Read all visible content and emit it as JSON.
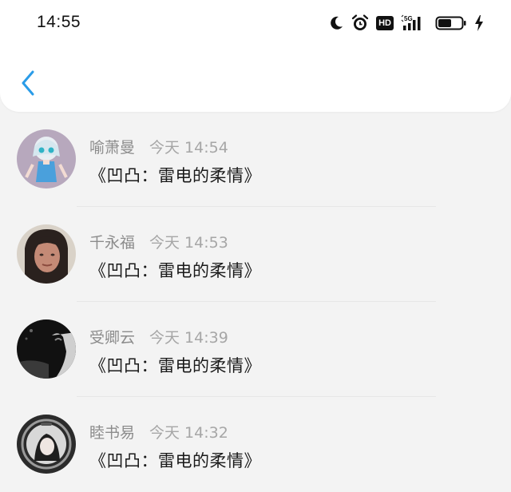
{
  "status_bar": {
    "time": "14:55",
    "network_label": "5G",
    "hd_label": "HD",
    "icons": [
      "moon-icon",
      "alarm-icon",
      "hd-icon",
      "signal-5g-icon",
      "battery-icon",
      "charging-icon"
    ]
  },
  "header": {
    "back_icon": "chevron-left-icon",
    "accent_color": "#2a9ce8"
  },
  "comments": [
    {
      "name": "喻萧曼",
      "time": "今天 14:54",
      "text": "《凹凸：雷电的柔情》"
    },
    {
      "name": "千永福",
      "time": "今天 14:53",
      "text": "《凹凸：雷电的柔情》"
    },
    {
      "name": "受卿云",
      "time": "今天 14:39",
      "text": "《凹凸：雷电的柔情》"
    },
    {
      "name": "睦书易",
      "time": "今天 14:32",
      "text": "《凹凸：雷电的柔情》"
    }
  ]
}
